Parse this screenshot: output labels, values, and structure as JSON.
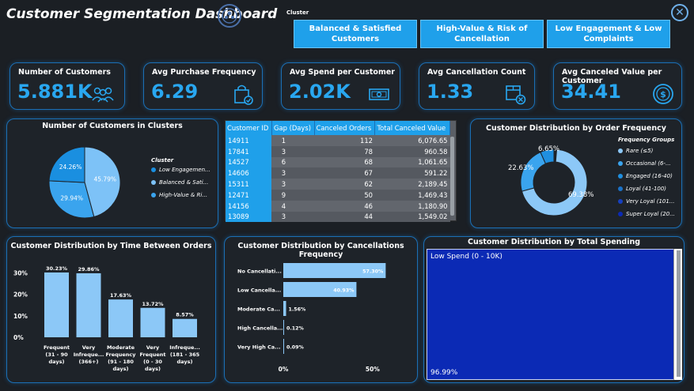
{
  "header": {
    "title": "Customer Segmentation Dashboard"
  },
  "slicer": {
    "label": "Cluster",
    "options": [
      "Balanced & Satisfied Customers",
      "High-Value & Risk of Cancellation",
      "Low Engagement & Low Complaints"
    ]
  },
  "kpis": [
    {
      "label": "Number of Customers",
      "value": "5.881K",
      "icon": "people-icon"
    },
    {
      "label": "Avg Purchase Frequency",
      "value": "6.29",
      "icon": "shopping-bag-icon"
    },
    {
      "label": "Avg Spend per Customer",
      "value": "2.02K",
      "icon": "money-icon"
    },
    {
      "label": "Avg Cancellation Count",
      "value": "1.33",
      "icon": "box-cancel-icon"
    },
    {
      "label": "Avg Canceled Value per Customer",
      "value": "34.41",
      "icon": "dollar-coin-icon"
    }
  ],
  "clusters_pie": {
    "title": "Number of Customers in Clusters",
    "legend_title": "Cluster",
    "legend": [
      "Low Engagemen...",
      "Balanced & Sati...",
      "High-Value & Ri..."
    ],
    "colors": {
      "low_engagement": "#1a8fe0",
      "balanced": "#7dc2f7",
      "high_value": "#3aa4ee"
    }
  },
  "cancel_table": {
    "columns": [
      "Customer ID",
      "Gap (Days)",
      "Canceled Orders",
      "Total Canceled Value"
    ],
    "rows": [
      [
        "14911",
        "1",
        "112",
        "6,076.65"
      ],
      [
        "17841",
        "3",
        "78",
        "960.58"
      ],
      [
        "14527",
        "6",
        "68",
        "1,061.65"
      ],
      [
        "14606",
        "3",
        "67",
        "591.22"
      ],
      [
        "15311",
        "3",
        "62",
        "2,189.45"
      ],
      [
        "12471",
        "9",
        "50",
        "1,469.43"
      ],
      [
        "14156",
        "4",
        "46",
        "1,180.90"
      ],
      [
        "13089",
        "3",
        "44",
        "1,549.02"
      ]
    ]
  },
  "order_freq": {
    "title": "Customer Distribution by Order Frequency",
    "legend_title": "Frequency Groups",
    "legend": [
      "Rare (≤5)",
      "Occasional (6-...",
      "Engaged (16-40)",
      "Loyal (41-100)",
      "Very Loyal (101...",
      "Super Loyal (20..."
    ],
    "legend_colors": [
      "#8cc8f7",
      "#3aa4ee",
      "#1f8fe0",
      "#1a72c8",
      "#1640c0",
      "#0b2ab5"
    ]
  },
  "time_between": {
    "title": "Customer Distribution by Time Between Orders",
    "y_ticks": [
      "30%",
      "20%",
      "10%",
      "0%"
    ],
    "x_labels": [
      [
        "Frequent",
        "(31 - 90",
        "days)"
      ],
      [
        "Very",
        "Infreque...",
        "(366+)"
      ],
      [
        "Moderate",
        "Frequency",
        "(91 - 180",
        "days)"
      ],
      [
        "Very",
        "Frequent",
        "(0 - 30",
        "days)"
      ],
      [
        "Infreque...",
        "(181 - 365",
        "days)"
      ]
    ]
  },
  "cancel_freq": {
    "title": "Customer Distribution by Cancellations Frequency",
    "x_ticks": [
      "0%",
      "50%"
    ]
  },
  "spending": {
    "title": "Customer Distribution by Total Spending",
    "label": "Low Spend (0 - 10K)",
    "pct": "96.99%"
  },
  "chart_data": [
    {
      "type": "pie",
      "title": "Number of Customers in Clusters",
      "categories": [
        "Low Engagemen...",
        "Balanced & Sati...",
        "High-Value & Ri..."
      ],
      "values": [
        45.79,
        29.94,
        24.26
      ],
      "labels": [
        "45.79%",
        "29.94%",
        "24.26%"
      ]
    },
    {
      "type": "pie",
      "title": "Customer Distribution by Order Frequency",
      "categories": [
        "Rare (≤5)",
        "Occasional (6-...",
        "Engaged (16-40)"
      ],
      "values": [
        69.38,
        22.63,
        6.65
      ],
      "labels": [
        "69.38%",
        "22.63%",
        "6.65%"
      ]
    },
    {
      "type": "bar",
      "title": "Customer Distribution by Time Between Orders",
      "categories": [
        "Frequent (31 - 90 days)",
        "Very Infreque... (366+)",
        "Moderate Frequency (91 - 180 days)",
        "Very Frequent (0 - 30 days)",
        "Infreque... (181 - 365 days)"
      ],
      "values": [
        30.23,
        29.86,
        17.63,
        13.72,
        8.57
      ],
      "labels": [
        "30.23%",
        "29.86%",
        "17.63%",
        "13.72%",
        "8.57%"
      ],
      "ylim": [
        0,
        35
      ]
    },
    {
      "type": "bar",
      "orientation": "horizontal",
      "title": "Customer Distribution by Cancellations Frequency",
      "categories": [
        "No Cancellati...",
        "Low Cancella...",
        "Moderate Ca...",
        "High Cancella...",
        "Very High Ca..."
      ],
      "values": [
        57.3,
        40.93,
        1.56,
        0.12,
        0.09
      ],
      "labels": [
        "57.30%",
        "40.93%",
        "1.56%",
        "0.12%",
        "0.09%"
      ],
      "xlim": [
        0,
        62
      ]
    },
    {
      "type": "treemap",
      "title": "Customer Distribution by Total Spending",
      "categories": [
        "Low Spend (0 - 10K)"
      ],
      "values": [
        96.99
      ],
      "labels": [
        "96.99%"
      ]
    }
  ]
}
